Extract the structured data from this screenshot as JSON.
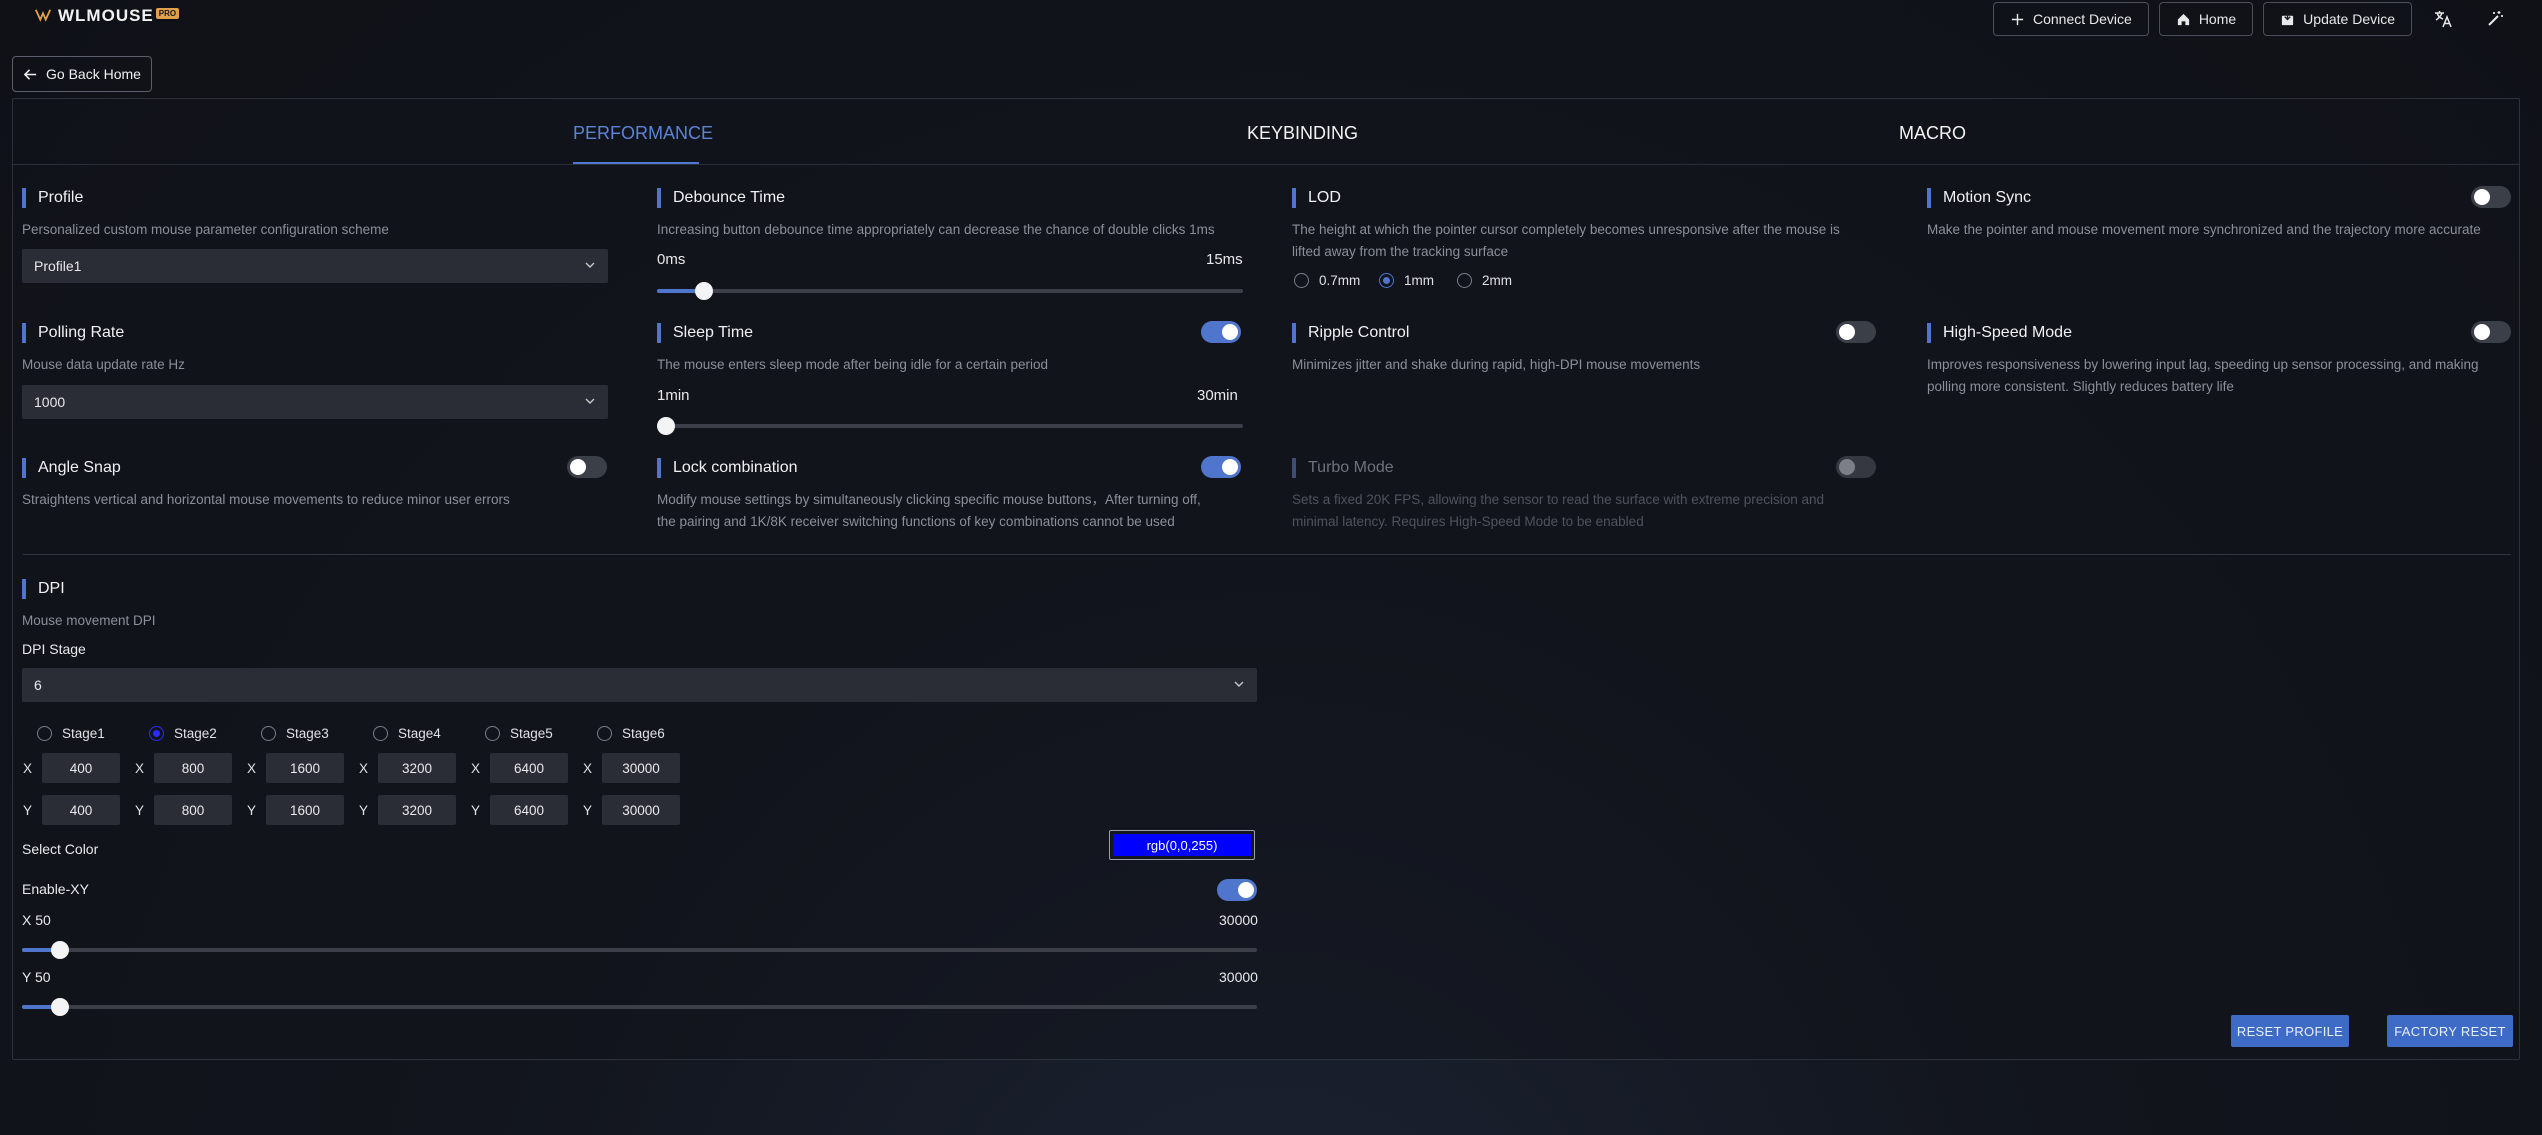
{
  "app": {
    "name": "WLMOUSE",
    "badge": "PRO"
  },
  "header": {
    "connect_label": "Connect Device",
    "home_label": "Home",
    "update_label": "Update Device"
  },
  "back_label": "Go Back Home",
  "tabs": [
    {
      "label": "PERFORMANCE",
      "active": true
    },
    {
      "label": "KEYBINDING",
      "active": false
    },
    {
      "label": "MACRO",
      "active": false
    }
  ],
  "profile": {
    "title": "Profile",
    "desc": "Personalized custom mouse parameter configuration scheme",
    "value": "Profile1"
  },
  "debounce": {
    "title": "Debounce Time",
    "desc": "Increasing button debounce time appropriately can decrease the chance of double clicks 1ms",
    "min_label": "0ms",
    "max_label": "15ms",
    "value_fraction": 0.08
  },
  "lod": {
    "title": "LOD",
    "desc_line1": "The height at which the pointer cursor completely becomes unresponsive after the mouse is",
    "desc_line2": "lifted away from the tracking surface",
    "options": [
      "0.7mm",
      "1mm",
      "2mm"
    ],
    "selected": "1mm"
  },
  "motion_sync": {
    "title": "Motion Sync",
    "desc": "Make the pointer and mouse movement more synchronized and the trajectory more accurate",
    "on": false
  },
  "polling": {
    "title": "Polling Rate",
    "desc": "Mouse data update rate Hz",
    "value": "1000"
  },
  "sleep": {
    "title": "Sleep Time",
    "desc": "The mouse enters sleep mode after being idle for a certain period",
    "min_label": "1min",
    "max_label": "30min",
    "on": true,
    "value_fraction": 0.0
  },
  "ripple": {
    "title": "Ripple Control",
    "desc": "Minimizes jitter and shake during rapid, high-DPI mouse movements",
    "on": false
  },
  "highspeed": {
    "title": "High-Speed Mode",
    "desc_line1": "Improves responsiveness by lowering input lag, speeding up sensor processing, and making",
    "desc_line2": "polling more consistent. Slightly reduces battery life",
    "on": false
  },
  "angle_snap": {
    "title": "Angle Snap",
    "desc": "Straightens vertical and horizontal mouse movements to reduce minor user errors",
    "on": false
  },
  "lock_combo": {
    "title": "Lock combination",
    "desc_line1": "Modify mouse settings by simultaneously clicking specific mouse buttons，After turning off,",
    "desc_line2": "the pairing and 1K/8K receiver switching functions of key combinations cannot be used",
    "on": true
  },
  "turbo": {
    "title": "Turbo Mode",
    "desc_line1": "Sets a fixed 20K FPS, allowing the sensor to read the surface with extreme precision and",
    "desc_line2": "minimal latency. Requires High-Speed Mode to be enabled",
    "on": false
  },
  "dpi": {
    "title": "DPI",
    "desc": "Mouse movement DPI",
    "stage_label": "DPI Stage",
    "stage_value": "6",
    "selected_stage": "Stage2",
    "stages": [
      {
        "name": "Stage1",
        "x": "400",
        "y": "400"
      },
      {
        "name": "Stage2",
        "x": "800",
        "y": "800"
      },
      {
        "name": "Stage3",
        "x": "1600",
        "y": "1600"
      },
      {
        "name": "Stage4",
        "x": "3200",
        "y": "3200"
      },
      {
        "name": "Stage5",
        "x": "6400",
        "y": "6400"
      },
      {
        "name": "Stage6",
        "x": "30000",
        "y": "30000"
      }
    ],
    "x_letter": "X",
    "y_letter": "Y",
    "select_color_label": "Select Color",
    "color_value": "rgb(0,0,255)",
    "color_hex": "#0000ff",
    "enable_xy_label": "Enable-XY",
    "enable_xy_on": true,
    "x_slider_label": "X 50",
    "x_slider_max": "30000",
    "x_slider_fraction": 0.0,
    "y_slider_label": "Y 50",
    "y_slider_max": "30000",
    "y_slider_fraction": 0.0
  },
  "actions": {
    "reset_profile": "RESET PROFILE",
    "factory_reset": "FACTORY RESET"
  },
  "colors": {
    "accent": "#4f76cc",
    "background": "#12151d",
    "panel": "#2a2d35"
  }
}
